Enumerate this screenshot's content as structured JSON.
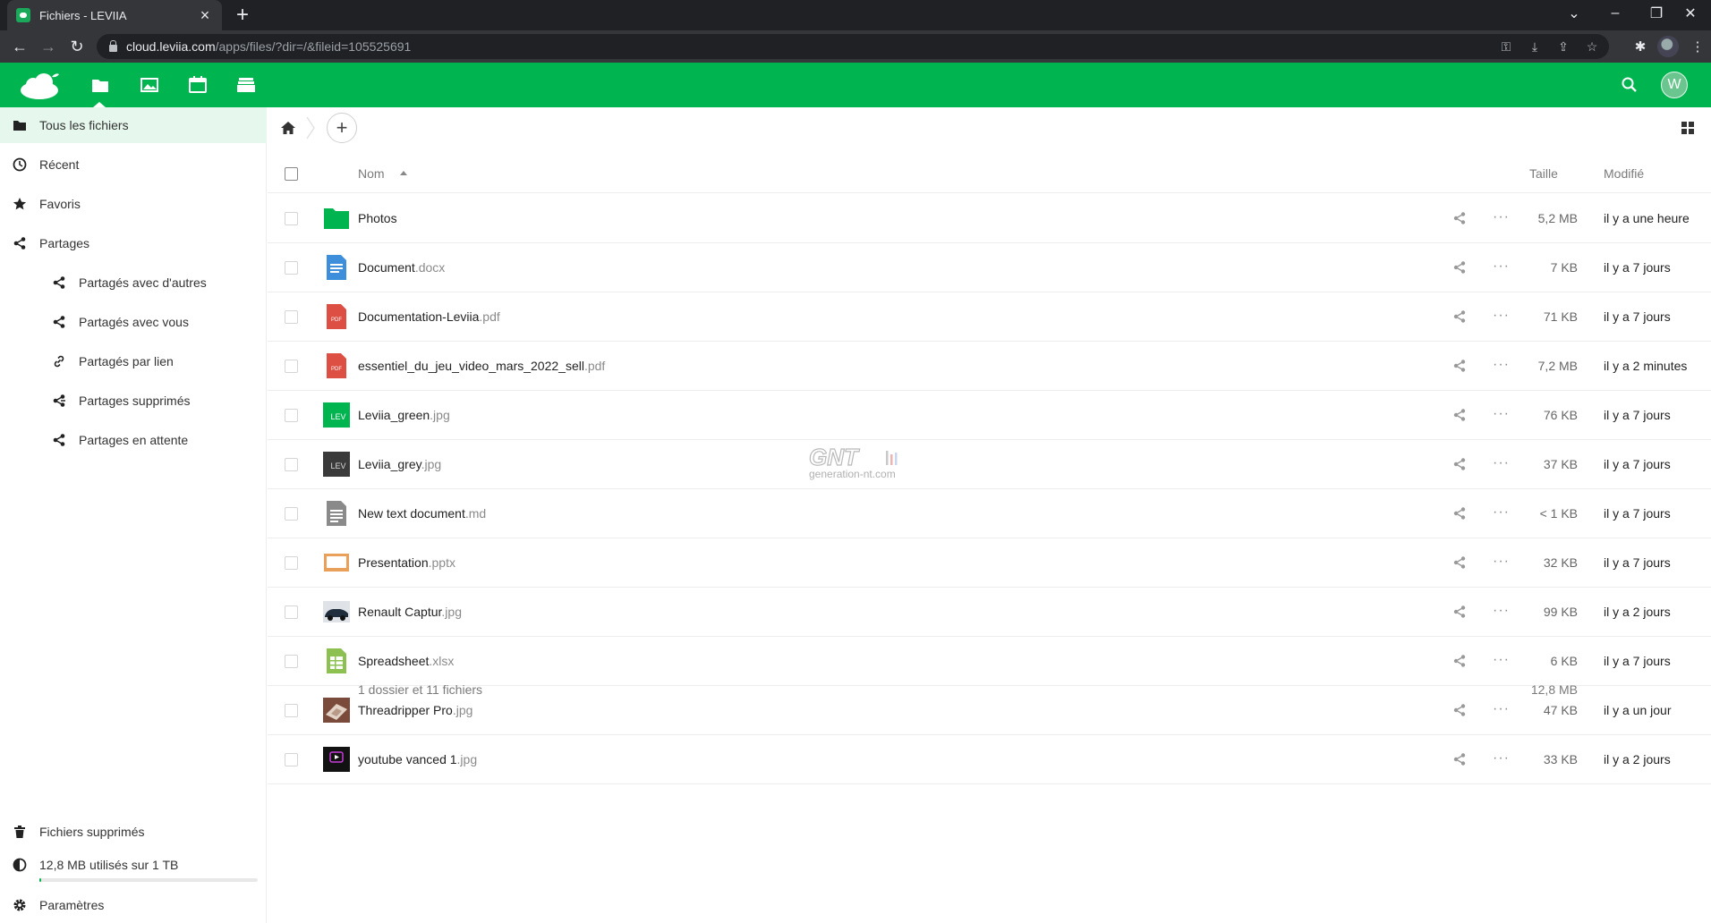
{
  "browser": {
    "tab_title": "Fichiers - LEVIIA",
    "tab_close": "×",
    "new_tab": "+",
    "url_host": "cloud.leviia.com",
    "url_path": "/apps/files/?dir=/&fileid=105525691"
  },
  "app": {
    "brand_color": "#00b44f",
    "avatar_letter": "W"
  },
  "sidebar": {
    "items": [
      {
        "label": "Tous les fichiers",
        "icon": "folder-icon"
      },
      {
        "label": "Récent",
        "icon": "clock-icon"
      },
      {
        "label": "Favoris",
        "icon": "star-icon"
      },
      {
        "label": "Partages",
        "icon": "share-icon"
      },
      {
        "label": "Partagés avec d'autres",
        "icon": "share-icon"
      },
      {
        "label": "Partagés avec vous",
        "icon": "share-icon"
      },
      {
        "label": "Partagés par lien",
        "icon": "link-icon"
      },
      {
        "label": "Partages supprimés",
        "icon": "share-deleted-icon"
      },
      {
        "label": "Partages en attente",
        "icon": "share-icon"
      }
    ],
    "trash_label": "Fichiers supprimés",
    "quota_label": "12,8 MB utilisés sur 1 TB",
    "settings_label": "Paramètres"
  },
  "table": {
    "col_name": "Nom",
    "col_size": "Taille",
    "col_modified": "Modifié",
    "rows": [
      {
        "name": "Photos",
        "ext": "",
        "size": "5,2 MB",
        "modified": "il y a une heure",
        "icon": "folder-icon"
      },
      {
        "name": "Document",
        "ext": ".docx",
        "size": "7 KB",
        "modified": "il y a 7 jours",
        "icon": "document-icon"
      },
      {
        "name": "Documentation-Leviia",
        "ext": ".pdf",
        "size": "71 KB",
        "modified": "il y a 7 jours",
        "icon": "pdf-icon"
      },
      {
        "name": "essentiel_du_jeu_video_mars_2022_sell",
        "ext": ".pdf",
        "size": "7,2 MB",
        "modified": "il y a 2 minutes",
        "icon": "pdf-icon"
      },
      {
        "name": "Leviia_green",
        "ext": ".jpg",
        "size": "76 KB",
        "modified": "il y a 7 jours",
        "icon": "image-thumb-green"
      },
      {
        "name": "Leviia_grey",
        "ext": ".jpg",
        "size": "37 KB",
        "modified": "il y a 7 jours",
        "icon": "image-thumb-grey"
      },
      {
        "name": "New text document",
        "ext": ".md",
        "size": "< 1 KB",
        "modified": "il y a 7 jours",
        "icon": "text-icon"
      },
      {
        "name": "Presentation",
        "ext": ".pptx",
        "size": "32 KB",
        "modified": "il y a 7 jours",
        "icon": "presentation-icon"
      },
      {
        "name": "Renault Captur",
        "ext": ".jpg",
        "size": "99 KB",
        "modified": "il y a 2 jours",
        "icon": "image-thumb-car"
      },
      {
        "name": "Spreadsheet",
        "ext": ".xlsx",
        "size": "6 KB",
        "modified": "il y a 7 jours",
        "icon": "spreadsheet-icon"
      },
      {
        "name": "Threadripper Pro",
        "ext": ".jpg",
        "size": "47 KB",
        "modified": "il y a un jour",
        "icon": "image-thumb-cpu"
      },
      {
        "name": "youtube vanced 1",
        "ext": ".jpg",
        "size": "33 KB",
        "modified": "il y a 2 jours",
        "icon": "image-thumb-video"
      }
    ],
    "summary_count": "1 dossier et 11 fichiers",
    "summary_size": "12,8 MB"
  },
  "add_label": "+",
  "more_label": "···",
  "thumb_text": "LEV",
  "watermark": {
    "main": "GNT",
    "sub": "generation-nt.com"
  }
}
